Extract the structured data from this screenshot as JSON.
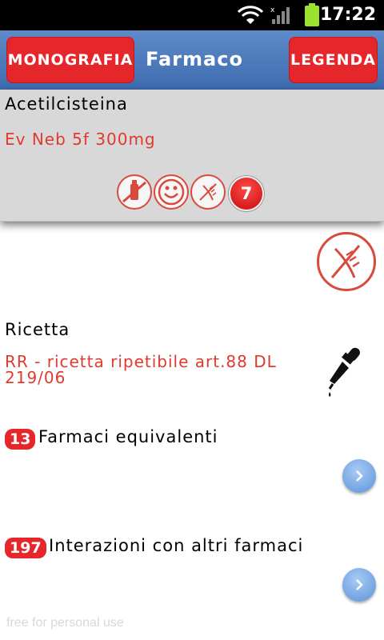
{
  "status_bar": {
    "time": "17:22"
  },
  "header": {
    "monografia_label": "MONOGRAFIA",
    "title": "Farmaco",
    "legenda_label": "LEGENDA"
  },
  "drug": {
    "name": "Acetilcisteina",
    "dose": "Ev Neb 5f 300mg",
    "icons": [
      "no-alcohol-icon",
      "smiley-icon",
      "gluten-free-icon"
    ],
    "badge_count": "7"
  },
  "gluten_section": {
    "icon": "gluten-free-icon"
  },
  "ricetta": {
    "title": "Ricetta",
    "text": "RR - ricetta ripetibile art.88 DL 219/06",
    "icon": "dropper-icon"
  },
  "equivalenti": {
    "count": "13",
    "title": "Farmaci equivalenti"
  },
  "interazioni": {
    "count": "197",
    "title": "Interazioni con altri farmaci"
  },
  "footer": {
    "note": "free for personal use"
  },
  "colors": {
    "accent_red": "#e5262a",
    "header_blue": "#4a76b8",
    "text_red": "#e03a2f"
  }
}
